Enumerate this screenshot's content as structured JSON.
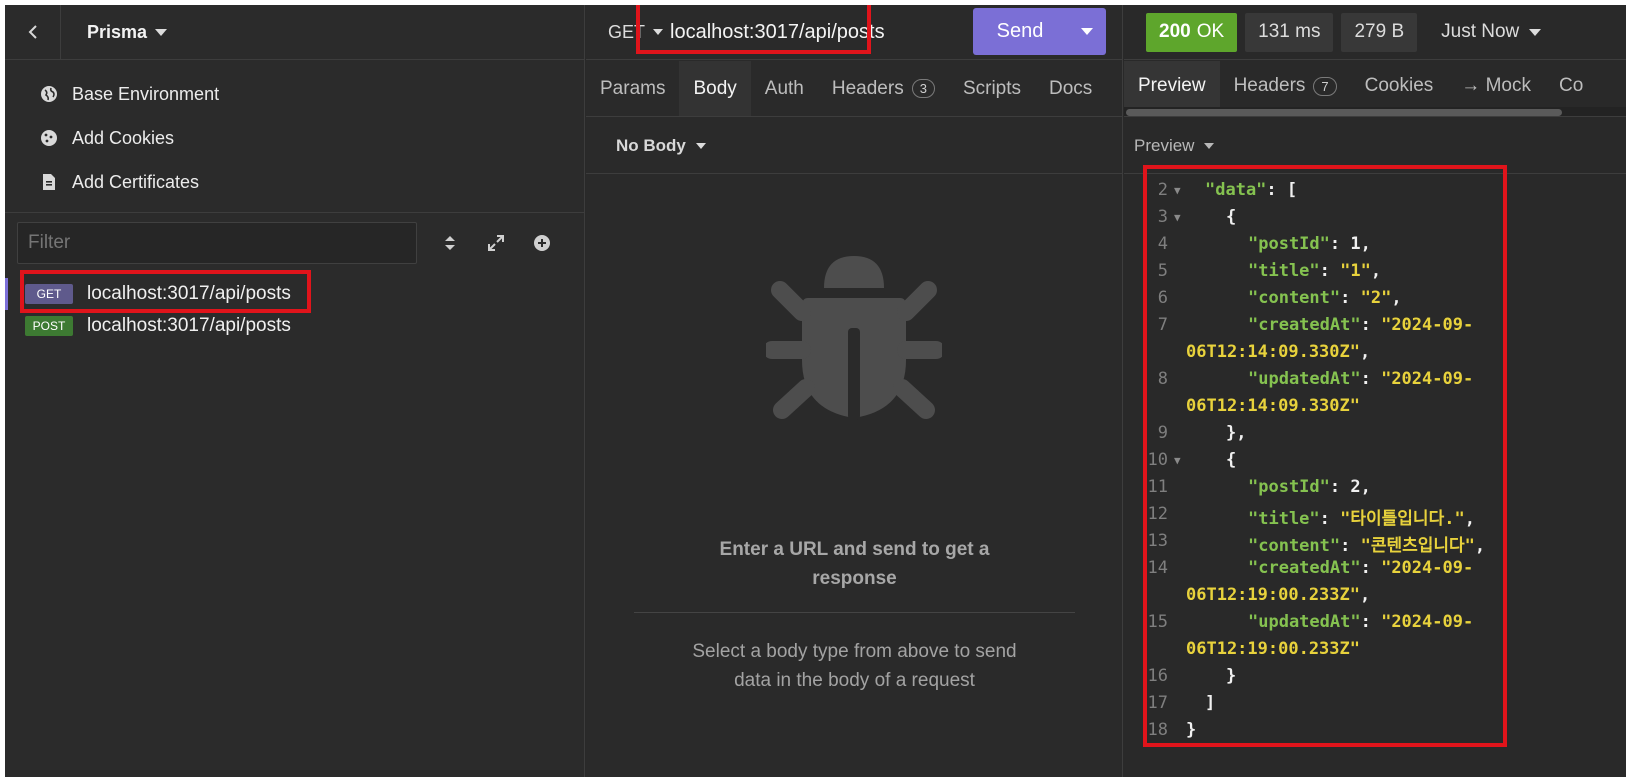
{
  "sidebar": {
    "project_name": "Prisma",
    "environment_items": [
      {
        "label": "Base Environment",
        "icon": "globe-icon"
      },
      {
        "label": "Add Cookies",
        "icon": "cookie-icon"
      },
      {
        "label": "Add Certificates",
        "icon": "certificate-icon"
      }
    ],
    "filter_placeholder": "Filter",
    "requests": [
      {
        "method": "GET",
        "url": "localhost:3017/api/posts",
        "active": true
      },
      {
        "method": "POST",
        "url": "localhost:3017/api/posts",
        "active": false
      }
    ]
  },
  "request": {
    "method": "GET",
    "url": "localhost:3017/api/posts",
    "send_label": "Send",
    "tabs": [
      {
        "label": "Params"
      },
      {
        "label": "Body",
        "active": true
      },
      {
        "label": "Auth"
      },
      {
        "label": "Headers",
        "count": "3"
      },
      {
        "label": "Scripts"
      },
      {
        "label": "Docs"
      }
    ],
    "body_type": "No Body",
    "empty_title": "Enter a URL and send to get a response",
    "empty_subtitle": "Select a body type from above to send data in the body of a request"
  },
  "response": {
    "status_code": "200",
    "status_text": "OK",
    "time": "131 ms",
    "size": "279 B",
    "when": "Just Now",
    "tabs": [
      {
        "label": "Preview",
        "active": true
      },
      {
        "label": "Headers",
        "count": "7"
      },
      {
        "label": "Cookies"
      },
      {
        "label": "→ Mock"
      },
      {
        "label": "Co"
      }
    ],
    "preview_mode": "Preview",
    "line_numbers": [
      "2",
      "3",
      "4",
      "5",
      "6",
      "7",
      "8",
      "9",
      "10",
      "11",
      "12",
      "13",
      "14",
      "15",
      "16",
      "17",
      "18"
    ],
    "posts": [
      {
        "postId": "1",
        "title": "\"1\"",
        "content": "\"2\"",
        "createdAt_1": "\"2024-09-",
        "createdAt_2": "06T12:14:09.330Z\"",
        "updatedAt_1": "\"2024-09-",
        "updatedAt_2": "06T12:14:09.330Z\""
      },
      {
        "postId": "2",
        "title": "\"타이틀입니다.\"",
        "content": "\"콘텐츠입니다\"",
        "createdAt_1": "\"2024-09-",
        "createdAt_2": "06T12:19:00.233Z\"",
        "updatedAt_1": "\"2024-09-",
        "updatedAt_2": "06T12:19:00.233Z\""
      }
    ],
    "keys": {
      "data": "\"data\"",
      "postId": "\"postId\"",
      "title": "\"title\"",
      "content": "\"content\"",
      "createdAt": "\"createdAt\"",
      "updatedAt": "\"updatedAt\""
    }
  },
  "colors": {
    "accent": "#7b6fd6",
    "status_ok": "#5ea62c",
    "json_key": "#85c250",
    "json_string": "#e8d23c",
    "highlight": "#e0141b"
  }
}
